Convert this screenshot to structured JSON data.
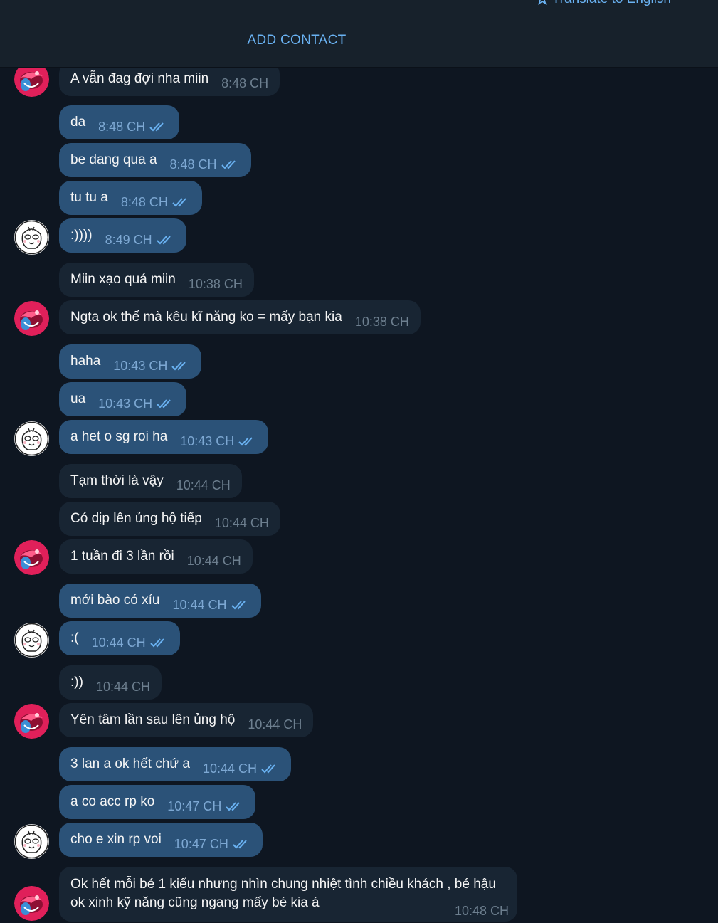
{
  "header": {
    "translate_label": "Translate to English",
    "add_contact_label": "ADD CONTACT"
  },
  "colors": {
    "background": "#0e1621",
    "incoming_bubble": "#182533",
    "outgoing_bubble": "#2b5278",
    "accent": "#6ab2f2"
  },
  "messages": [
    {
      "dir": "in",
      "text": "A vẫn đag đợi nha miin",
      "time": "8:48 CH"
    },
    {
      "dir": "out",
      "text": "da",
      "time": "8:48 CH",
      "read": true
    },
    {
      "dir": "out",
      "text": "be dang qua a",
      "time": "8:48 CH",
      "read": true
    },
    {
      "dir": "out",
      "text": "tu tu a",
      "time": "8:48 CH",
      "read": true
    },
    {
      "dir": "out",
      "text": ":))))",
      "time": "8:49 CH",
      "read": true
    },
    {
      "dir": "in",
      "text": "Miin xạo quá miin",
      "time": "10:38 CH"
    },
    {
      "dir": "in",
      "text": "Ngta ok thế mà kêu kĩ năng ko = mấy bạn kia",
      "time": "10:38 CH"
    },
    {
      "dir": "out",
      "text": "haha",
      "time": "10:43 CH",
      "read": true
    },
    {
      "dir": "out",
      "text": "ua",
      "time": "10:43 CH",
      "read": true
    },
    {
      "dir": "out",
      "text": "a het o sg roi ha",
      "time": "10:43 CH",
      "read": true
    },
    {
      "dir": "in",
      "text": "Tạm thời là vậy",
      "time": "10:44 CH"
    },
    {
      "dir": "in",
      "text": "Có dịp lên ủng hộ tiếp",
      "time": "10:44 CH"
    },
    {
      "dir": "in",
      "text": "1 tuần đi 3 lần rồi",
      "time": "10:44 CH"
    },
    {
      "dir": "out",
      "text": "mới bào có xíu",
      "time": "10:44 CH",
      "read": true
    },
    {
      "dir": "out",
      "text": ":(",
      "time": "10:44 CH",
      "read": true
    },
    {
      "dir": "in",
      "text": ":))",
      "time": "10:44 CH"
    },
    {
      "dir": "in",
      "text": "Yên tâm lần sau lên ủng hộ",
      "time": "10:44 CH"
    },
    {
      "dir": "out",
      "text": "3 lan a ok hết chứ a",
      "time": "10:44 CH",
      "read": true
    },
    {
      "dir": "out",
      "text": "a co acc rp ko",
      "time": "10:47 CH",
      "read": true
    },
    {
      "dir": "out",
      "text": "cho e xin rp voi",
      "time": "10:47 CH",
      "read": true
    },
    {
      "dir": "in",
      "text": "Ok hết mỗi bé 1 kiểu nhưng nhìn chung nhiệt tình chiều khách , bé hậu ok xinh kỹ năng cũng ngang mấy bé kia á",
      "time": "10:48 CH"
    }
  ]
}
